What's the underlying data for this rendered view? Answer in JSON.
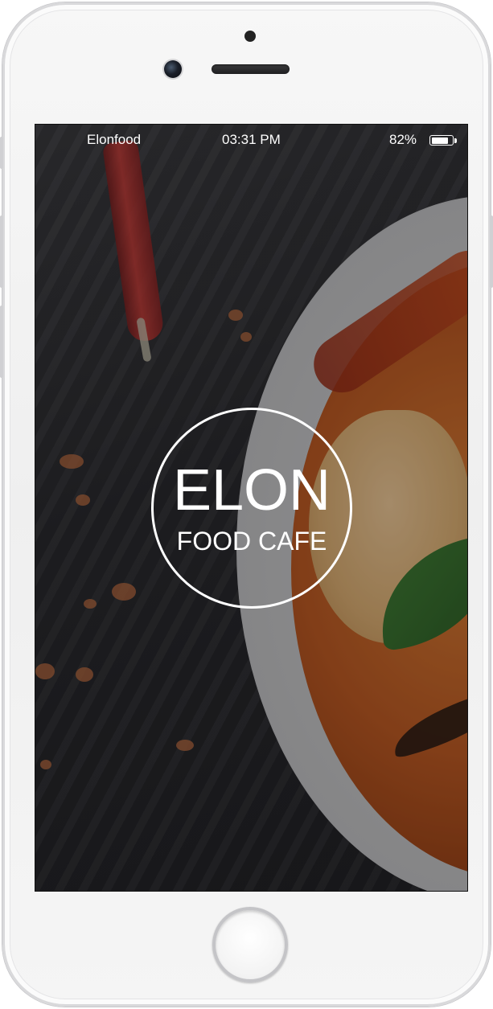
{
  "status_bar": {
    "carrier": "Elonfood",
    "time": "03:31 PM",
    "battery_percent": "82%",
    "battery_level": 0.82
  },
  "splash": {
    "logo_title": "ELON",
    "logo_subtitle": "FOOD CAFE"
  },
  "device": {
    "frame_color": "#f2f2f2",
    "icons": [
      "front-camera-icon",
      "earpiece-speaker",
      "proximity-sensor-icon",
      "home-button"
    ]
  }
}
